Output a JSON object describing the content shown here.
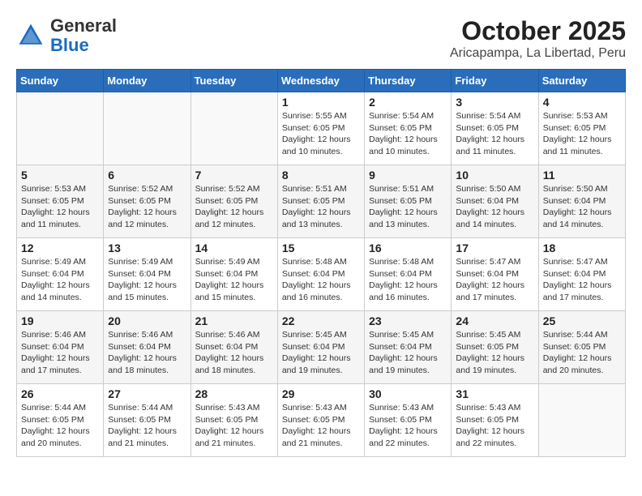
{
  "header": {
    "logo": {
      "general": "General",
      "blue": "Blue"
    },
    "title": "October 2025",
    "location": "Aricapampa, La Libertad, Peru"
  },
  "calendar": {
    "weekdays": [
      "Sunday",
      "Monday",
      "Tuesday",
      "Wednesday",
      "Thursday",
      "Friday",
      "Saturday"
    ],
    "weeks": [
      [
        {
          "day": "",
          "info": ""
        },
        {
          "day": "",
          "info": ""
        },
        {
          "day": "",
          "info": ""
        },
        {
          "day": "1",
          "info": "Sunrise: 5:55 AM\nSunset: 6:05 PM\nDaylight: 12 hours\nand 10 minutes."
        },
        {
          "day": "2",
          "info": "Sunrise: 5:54 AM\nSunset: 6:05 PM\nDaylight: 12 hours\nand 10 minutes."
        },
        {
          "day": "3",
          "info": "Sunrise: 5:54 AM\nSunset: 6:05 PM\nDaylight: 12 hours\nand 11 minutes."
        },
        {
          "day": "4",
          "info": "Sunrise: 5:53 AM\nSunset: 6:05 PM\nDaylight: 12 hours\nand 11 minutes."
        }
      ],
      [
        {
          "day": "5",
          "info": "Sunrise: 5:53 AM\nSunset: 6:05 PM\nDaylight: 12 hours\nand 11 minutes."
        },
        {
          "day": "6",
          "info": "Sunrise: 5:52 AM\nSunset: 6:05 PM\nDaylight: 12 hours\nand 12 minutes."
        },
        {
          "day": "7",
          "info": "Sunrise: 5:52 AM\nSunset: 6:05 PM\nDaylight: 12 hours\nand 12 minutes."
        },
        {
          "day": "8",
          "info": "Sunrise: 5:51 AM\nSunset: 6:05 PM\nDaylight: 12 hours\nand 13 minutes."
        },
        {
          "day": "9",
          "info": "Sunrise: 5:51 AM\nSunset: 6:05 PM\nDaylight: 12 hours\nand 13 minutes."
        },
        {
          "day": "10",
          "info": "Sunrise: 5:50 AM\nSunset: 6:04 PM\nDaylight: 12 hours\nand 14 minutes."
        },
        {
          "day": "11",
          "info": "Sunrise: 5:50 AM\nSunset: 6:04 PM\nDaylight: 12 hours\nand 14 minutes."
        }
      ],
      [
        {
          "day": "12",
          "info": "Sunrise: 5:49 AM\nSunset: 6:04 PM\nDaylight: 12 hours\nand 14 minutes."
        },
        {
          "day": "13",
          "info": "Sunrise: 5:49 AM\nSunset: 6:04 PM\nDaylight: 12 hours\nand 15 minutes."
        },
        {
          "day": "14",
          "info": "Sunrise: 5:49 AM\nSunset: 6:04 PM\nDaylight: 12 hours\nand 15 minutes."
        },
        {
          "day": "15",
          "info": "Sunrise: 5:48 AM\nSunset: 6:04 PM\nDaylight: 12 hours\nand 16 minutes."
        },
        {
          "day": "16",
          "info": "Sunrise: 5:48 AM\nSunset: 6:04 PM\nDaylight: 12 hours\nand 16 minutes."
        },
        {
          "day": "17",
          "info": "Sunrise: 5:47 AM\nSunset: 6:04 PM\nDaylight: 12 hours\nand 17 minutes."
        },
        {
          "day": "18",
          "info": "Sunrise: 5:47 AM\nSunset: 6:04 PM\nDaylight: 12 hours\nand 17 minutes."
        }
      ],
      [
        {
          "day": "19",
          "info": "Sunrise: 5:46 AM\nSunset: 6:04 PM\nDaylight: 12 hours\nand 17 minutes."
        },
        {
          "day": "20",
          "info": "Sunrise: 5:46 AM\nSunset: 6:04 PM\nDaylight: 12 hours\nand 18 minutes."
        },
        {
          "day": "21",
          "info": "Sunrise: 5:46 AM\nSunset: 6:04 PM\nDaylight: 12 hours\nand 18 minutes."
        },
        {
          "day": "22",
          "info": "Sunrise: 5:45 AM\nSunset: 6:04 PM\nDaylight: 12 hours\nand 19 minutes."
        },
        {
          "day": "23",
          "info": "Sunrise: 5:45 AM\nSunset: 6:04 PM\nDaylight: 12 hours\nand 19 minutes."
        },
        {
          "day": "24",
          "info": "Sunrise: 5:45 AM\nSunset: 6:05 PM\nDaylight: 12 hours\nand 19 minutes."
        },
        {
          "day": "25",
          "info": "Sunrise: 5:44 AM\nSunset: 6:05 PM\nDaylight: 12 hours\nand 20 minutes."
        }
      ],
      [
        {
          "day": "26",
          "info": "Sunrise: 5:44 AM\nSunset: 6:05 PM\nDaylight: 12 hours\nand 20 minutes."
        },
        {
          "day": "27",
          "info": "Sunrise: 5:44 AM\nSunset: 6:05 PM\nDaylight: 12 hours\nand 21 minutes."
        },
        {
          "day": "28",
          "info": "Sunrise: 5:43 AM\nSunset: 6:05 PM\nDaylight: 12 hours\nand 21 minutes."
        },
        {
          "day": "29",
          "info": "Sunrise: 5:43 AM\nSunset: 6:05 PM\nDaylight: 12 hours\nand 21 minutes."
        },
        {
          "day": "30",
          "info": "Sunrise: 5:43 AM\nSunset: 6:05 PM\nDaylight: 12 hours\nand 22 minutes."
        },
        {
          "day": "31",
          "info": "Sunrise: 5:43 AM\nSunset: 6:05 PM\nDaylight: 12 hours\nand 22 minutes."
        },
        {
          "day": "",
          "info": ""
        }
      ]
    ]
  }
}
